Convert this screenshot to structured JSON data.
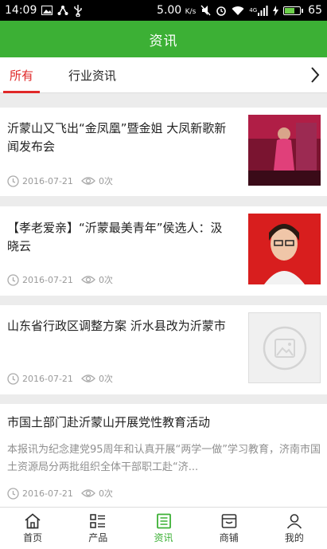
{
  "status_bar": {
    "time": "14:09",
    "speed": "5.00",
    "speed_unit": "K/s",
    "network": "4G",
    "battery": "65",
    "battery_level": 0.65
  },
  "header": {
    "title": "资讯"
  },
  "tabs": [
    {
      "label": "所有",
      "active": true
    },
    {
      "label": "行业资讯",
      "active": false
    }
  ],
  "articles": [
    {
      "title": "沂蒙山又飞出“金凤凰”暨金姐 大凤新歌新闻发布会",
      "date": "2016-07-21",
      "views": "0次",
      "image": "singer-photo"
    },
    {
      "title": "【孝老爱亲】“沂蒙最美青年”侯选人：汲晓云",
      "date": "2016-07-21",
      "views": "0次",
      "image": "portrait-photo"
    },
    {
      "title": "山东省行政区调整方案 沂水县改为沂蒙市",
      "date": "2016-07-21",
      "views": "0次",
      "image": "placeholder-image"
    },
    {
      "title": "市国土部门赴沂蒙山开展党性教育活动",
      "summary": "本报讯为纪念建党95周年和认真开展“两学一做”学习教育，济南市国土资源局分两批组织全体干部职工赴“济...",
      "date": "2016-07-21",
      "views": "0次"
    }
  ],
  "bottom_nav": [
    {
      "label": "首页",
      "icon": "home-icon",
      "active": false
    },
    {
      "label": "产品",
      "icon": "product-grid-icon",
      "active": false
    },
    {
      "label": "资讯",
      "icon": "news-icon",
      "active": true
    },
    {
      "label": "商铺",
      "icon": "shop-icon",
      "active": false
    },
    {
      "label": "我的",
      "icon": "user-icon",
      "active": false
    }
  ],
  "colors": {
    "brand_green": "#3cb035",
    "tab_active_red": "#e02828"
  }
}
